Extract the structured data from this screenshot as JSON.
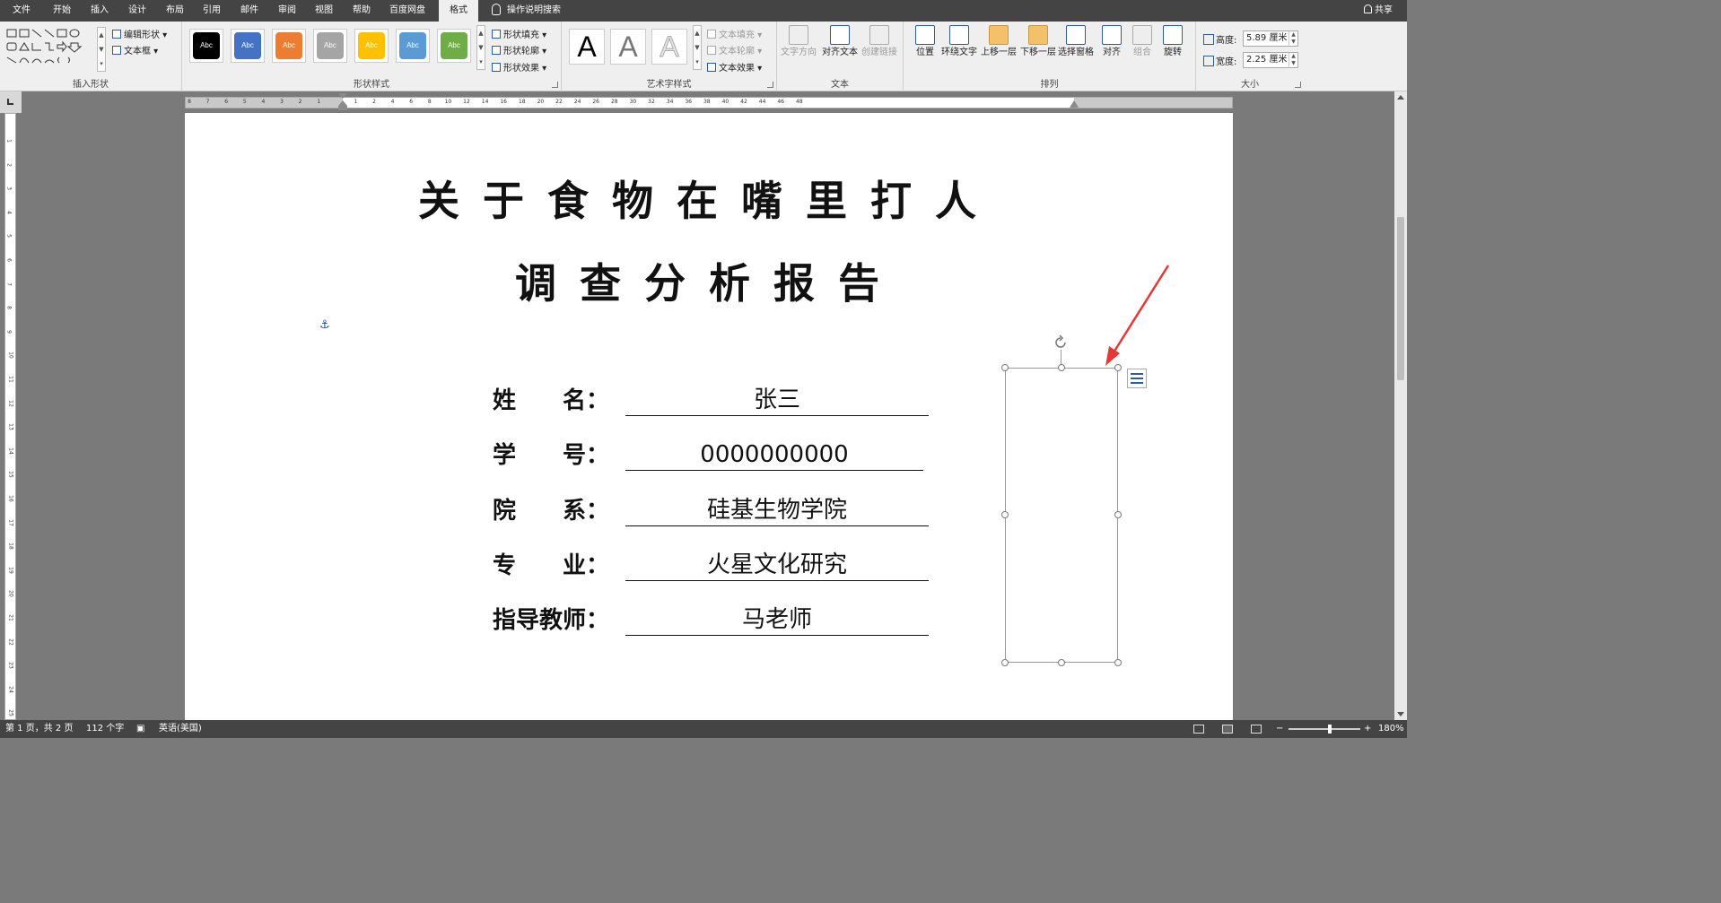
{
  "menu": {
    "items": [
      "文件",
      "开始",
      "插入",
      "设计",
      "布局",
      "引用",
      "邮件",
      "审阅",
      "视图",
      "帮助",
      "百度网盘",
      "格式"
    ],
    "active": "格式",
    "tell_me": "操作说明搜索",
    "share": "共享"
  },
  "ribbon": {
    "insert_shapes": {
      "edit_shape": "编辑形状",
      "text_box": "文本框",
      "label": "插入形状"
    },
    "shape_styles": {
      "swatches": [
        {
          "text": "Abc",
          "color": "#000000"
        },
        {
          "text": "Abc",
          "color": "#4472c4"
        },
        {
          "text": "Abc",
          "color": "#ed7d31"
        },
        {
          "text": "Abc",
          "color": "#a5a5a5"
        },
        {
          "text": "Abc",
          "color": "#ffc000"
        },
        {
          "text": "Abc",
          "color": "#5b9bd5"
        },
        {
          "text": "Abc",
          "color": "#70ad47"
        }
      ],
      "fill": "形状填充",
      "outline": "形状轮廓",
      "effects": "形状效果",
      "label": "形状样式"
    },
    "wordart": {
      "letters": [
        "A",
        "A",
        "A"
      ],
      "text_fill": "文本填充",
      "text_outline": "文本轮廓",
      "text_effects": "文本效果",
      "label": "艺术字样式"
    },
    "text": {
      "direction": "文字方向",
      "align_text": "对齐文本",
      "create_link": "创建链接",
      "label": "文本"
    },
    "arrange": {
      "position": "位置",
      "wrap_text": "环绕文字",
      "bring_forward": "上移一层",
      "send_backward": "下移一层",
      "selection_pane": "选择窗格",
      "align": "对齐",
      "group": "组合",
      "rotate": "旋转",
      "label": "排列"
    },
    "size": {
      "height_label": "高度:",
      "height_value": "5.89 厘米",
      "width_label": "宽度:",
      "width_value": "2.25 厘米",
      "label": "大小"
    }
  },
  "ruler": {
    "h_ticks": [
      "8",
      "7",
      "6",
      "5",
      "4",
      "3",
      "2",
      "1",
      "",
      "1",
      "2",
      "4",
      "6",
      "8",
      "10",
      "12",
      "14",
      "16",
      "18",
      "20",
      "22",
      "24",
      "26",
      "28",
      "30",
      "32",
      "34",
      "36",
      "38",
      "40",
      "42",
      "44",
      "46",
      "48"
    ],
    "v_ticks": [
      "1",
      "2",
      "3",
      "4",
      "5",
      "6",
      "7",
      "8",
      "9",
      "10",
      "11",
      "12",
      "13",
      "14",
      "15",
      "16",
      "17",
      "18",
      "19",
      "20",
      "21",
      "22",
      "23",
      "24",
      "25"
    ]
  },
  "document": {
    "title_line1": "关于食物在嘴里打人",
    "title_line2": "调查分析报告",
    "fields": [
      {
        "label": "姓　　名：",
        "value": "张三"
      },
      {
        "label": "学　　号：",
        "value": "0000000000"
      },
      {
        "label": "院　　系：",
        "value": "硅基生物学院"
      },
      {
        "label": "专　　业：",
        "value": "火星文化研究"
      },
      {
        "label": "指导教师：",
        "value": "马老师"
      }
    ]
  },
  "status": {
    "page": "第 1 页，共 2 页",
    "words": "112 个字",
    "language": "英语(美国)",
    "zoom": "180%"
  },
  "colors": {
    "title_bar": "#444444",
    "ribbon_bg": "#efefef",
    "doc_bg": "#7a7a7a",
    "annotation_arrow": "#e53935"
  }
}
